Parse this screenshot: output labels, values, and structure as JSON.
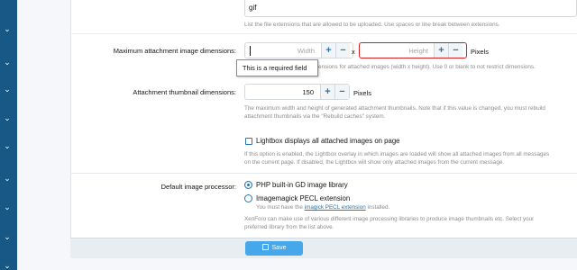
{
  "filetypes": {
    "last_visible_line": "gif",
    "hint": "List the file extensions that are allowed to be uploaded. Use spaces or line break between extensions."
  },
  "max_dimensions": {
    "label": "Maximum attachment image dimensions:",
    "width_placeholder": "Width",
    "height_placeholder": "Height",
    "separator": "x",
    "unit": "Pixels",
    "hint_visible": "ensions for attached images (width x height). Use 0 or blank to not restrict dimensions.",
    "tooltip": "This is a required field"
  },
  "thumbnail": {
    "label": "Attachment thumbnail dimensions:",
    "value": "150",
    "unit": "Pixels",
    "hint_line1": "The maximum width and height of generated attachment thumbnails. Note that if this value is changed, you must rebuild",
    "hint_line2": "attachment thumbnails via the \"Rebuild caches\" system."
  },
  "lightbox": {
    "label": "Lightbox displays all attached images on page",
    "hint_line1": "If this option is enabled, the Lightbox overlay in which images are loaded will show all attached images from all messages",
    "hint_line2": "on the current page. If disabled, the Lightbox will show only attached images from the current message.",
    "checked": false
  },
  "image_processor": {
    "label": "Default image processor:",
    "options": [
      {
        "label": "PHP built-in GD image library",
        "selected": true
      },
      {
        "label": "Imagemagick PECL extension",
        "selected": false
      }
    ],
    "imagick_hint_pre": "You must have the",
    "imagick_hint_link": "imagick PECL extension",
    "imagick_hint_post": "installed.",
    "hint_line1": "XenForo can make use of various different image processing libraries to produce image thumbnails etc. Select your",
    "hint_line2": "preferred library from the list above."
  },
  "buttons": {
    "save": "Save",
    "plus": "+",
    "minus": "−"
  },
  "icons": {
    "sidebar": "chevron-down-icon",
    "save": "save-icon"
  },
  "colors": {
    "sidebar": "#185886",
    "accent": "#2577b1",
    "save_button": "#47a7eb",
    "error_border": "#d61e1e"
  }
}
